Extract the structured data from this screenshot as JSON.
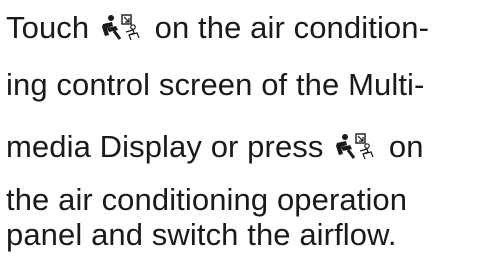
{
  "document": {
    "lines": [
      {
        "before": "Touch ",
        "after": " on the air condition-",
        "icon": "airflow-mode-icon"
      },
      {
        "text": "ing control screen of the Multi-"
      },
      {
        "before": "media Display or press ",
        "after": " on",
        "icon": "airflow-mode-icon"
      },
      {
        "text": "the air conditioning operation"
      },
      {
        "text": "panel and switch the airflow."
      }
    ]
  }
}
